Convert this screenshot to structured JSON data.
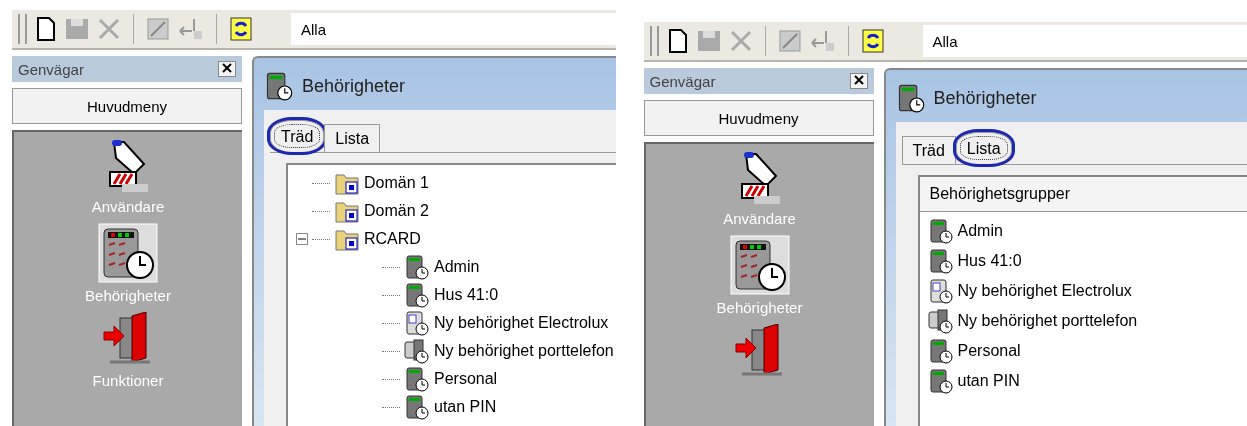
{
  "panels": [
    {
      "toolbar": {
        "filter": "Alla"
      },
      "shortcuts": {
        "title": "Genvägar",
        "menu": "Huvudmeny",
        "items": [
          {
            "kind": "user",
            "label": "Användare"
          },
          {
            "kind": "keypad",
            "label": "Behörigheter"
          },
          {
            "kind": "exit",
            "label": "Funktioner"
          }
        ]
      },
      "window": {
        "title": "Behörigheter",
        "tabs": [
          {
            "label": "Träd",
            "selected": true
          },
          {
            "label": "Lista",
            "selected": false
          }
        ],
        "content": {
          "kind": "tree",
          "nodes": [
            {
              "kind": "folder",
              "label": "Domän 1"
            },
            {
              "kind": "folder",
              "label": "Domän 2"
            },
            {
              "kind": "folder",
              "label": "RCARD",
              "expanded": true,
              "children": [
                {
                  "kind": "keypad",
                  "label": "Admin"
                },
                {
                  "kind": "keypad",
                  "label": "Hus 41:0"
                },
                {
                  "kind": "reader",
                  "label": "Ny behörighet Electrolux"
                },
                {
                  "kind": "intercom",
                  "label": "Ny behörighet porttelefon"
                },
                {
                  "kind": "keypad",
                  "label": "Personal"
                },
                {
                  "kind": "keypad",
                  "label": "utan PIN"
                }
              ]
            }
          ]
        }
      }
    },
    {
      "toolbar": {
        "filter": "Alla"
      },
      "shortcuts": {
        "title": "Genvägar",
        "menu": "Huvudmeny",
        "items": [
          {
            "kind": "user",
            "label": "Användare"
          },
          {
            "kind": "keypad",
            "label": "Behörigheter"
          },
          {
            "kind": "exit"
          }
        ]
      },
      "window": {
        "title": "Behörigheter",
        "tabs": [
          {
            "label": "Träd",
            "selected": false
          },
          {
            "label": "Lista",
            "selected": true
          }
        ],
        "content": {
          "kind": "list",
          "column": "Behörighetsgrupper",
          "rows": [
            {
              "kind": "keypad",
              "label": "Admin"
            },
            {
              "kind": "keypad",
              "label": "Hus 41:0"
            },
            {
              "kind": "reader",
              "label": "Ny behörighet Electrolux"
            },
            {
              "kind": "intercom",
              "label": "Ny behörighet porttelefon"
            },
            {
              "kind": "keypad",
              "label": "Personal"
            },
            {
              "kind": "keypad",
              "label": "utan PIN"
            }
          ]
        }
      }
    }
  ]
}
